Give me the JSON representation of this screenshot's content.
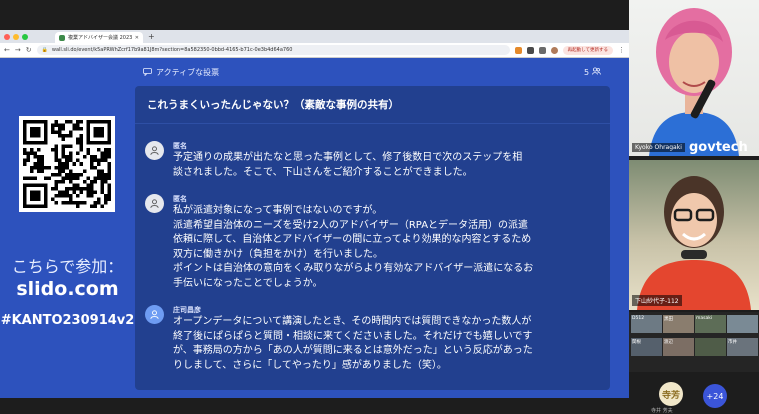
{
  "browser": {
    "tab_title": "複業アドバイザー会議 2023（関東",
    "url": "wall.sli.do/event/k5aPRWhZcrf17b9a81J8m?section=8a582350-0bbd-4165-b71c-0e3b4d64a760",
    "update_button": "再起動して更新する"
  },
  "slido": {
    "join_label": "こちらで参加：",
    "join_url": "slido.com",
    "join_code": "#KANTO230914v2",
    "poll_header": "アクティブな投票",
    "participant_count": "5",
    "poll_title": "これうまくいったんじゃない？（素敵な事例の共有）",
    "questions": [
      {
        "author": "匿名",
        "lines": [
          "予定通りの成果が出たなと思った事例として、修了後数日で次のステップを相",
          "談されました。そこで、下山さんをご紹介することができました。"
        ]
      },
      {
        "author": "匿名",
        "lines": [
          "私が派遣対象になって事例ではないのですが。",
          "派遣希望自治体のニーズを受け2人のアドバイザー（RPAとデータ活用）の派遣",
          "依頼に際して、自治体とアドバイザーの間に立ってより効果的な内容とするため",
          "双方に働きかけ（負担をかけ）を行いました。",
          "ポイントは自治体の意向をくみ取りながらより有効なアドバイザー派遣になるお",
          "手伝いになったことでしょうか。"
        ]
      },
      {
        "author": "庄司昌彦",
        "lines": [
          "オープンデータについて講演したとき、その時間内では質問できなかった数人が",
          "終了後にぱらぱらと質問・相談に来てくださいました。それだけでも嬉しいです",
          "が、事務局の方から「あの人が質問に来るとは意外だった」という反応があった",
          "りしまして、さらに「してやったり」感がありました（笑）。"
        ]
      }
    ]
  },
  "video": {
    "tile1_name": "Kyoko Ohragaki",
    "tile1_shirt_text": "govtech",
    "tile2_name": "下山紗代子-112",
    "thumbs": [
      "D512",
      "黒田",
      "masaki",
      "関根",
      "渡辺",
      "市井"
    ],
    "bottom_avatar": "寺芳",
    "bottom_name": "寺井 芳夫",
    "more_count": "+24"
  }
}
